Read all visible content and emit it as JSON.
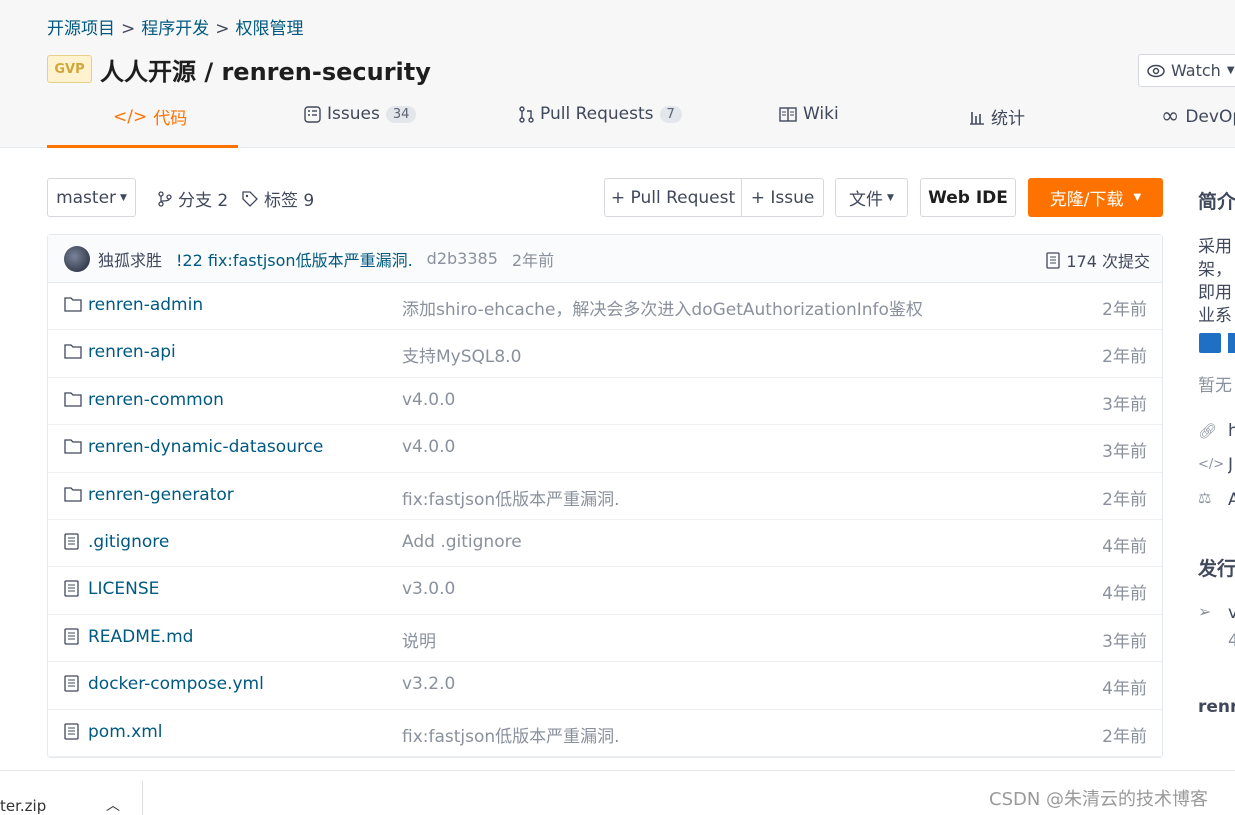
{
  "breadcrumb": {
    "items": [
      "开源项目",
      "程序开发",
      "权限管理"
    ],
    "sep": ">"
  },
  "repo": {
    "badge": "GVP",
    "title": "人人开源 / renren-security",
    "watch": "Watch"
  },
  "tabs": [
    {
      "label": "代码",
      "count": ""
    },
    {
      "label": "Issues",
      "count": "34"
    },
    {
      "label": "Pull Requests",
      "count": "7"
    },
    {
      "label": "Wiki",
      "count": ""
    },
    {
      "label": "统计",
      "count": ""
    },
    {
      "label": "DevOps",
      "count": ""
    }
  ],
  "toolbar": {
    "branch": "master",
    "branches": "分支 2",
    "tags": "标签 9",
    "pull_request": "+ Pull Request",
    "issue": "+ Issue",
    "file": "文件",
    "web_ide": "Web IDE",
    "clone": "克隆/下载"
  },
  "commit": {
    "author": "独孤求胜",
    "message": "!22 fix:fastjson低版本严重漏洞.",
    "hash": "d2b3385",
    "time": "2年前",
    "count": "174 次提交"
  },
  "files": [
    {
      "name": "renren-admin",
      "type": "folder",
      "message": "添加shiro-ehcache，解决会多次进入doGetAuthorizationInfo鉴权",
      "time": "2年前"
    },
    {
      "name": "renren-api",
      "type": "folder",
      "message": "支持MySQL8.0",
      "time": "2年前"
    },
    {
      "name": "renren-common",
      "type": "folder",
      "message": "v4.0.0",
      "time": "3年前"
    },
    {
      "name": "renren-dynamic-datasource",
      "type": "folder",
      "message": "v4.0.0",
      "time": "3年前"
    },
    {
      "name": "renren-generator",
      "type": "folder",
      "message": "fix:fastjson低版本严重漏洞.",
      "time": "2年前"
    },
    {
      "name": ".gitignore",
      "type": "file",
      "message": "Add .gitignore",
      "time": "4年前"
    },
    {
      "name": "LICENSE",
      "type": "file",
      "message": "v3.0.0",
      "time": "4年前"
    },
    {
      "name": "README.md",
      "type": "file",
      "message": "说明",
      "time": "3年前"
    },
    {
      "name": "docker-compose.yml",
      "type": "file",
      "message": "v3.2.0",
      "time": "4年前"
    },
    {
      "name": "pom.xml",
      "type": "file",
      "message": "fix:fastjson低版本严重漏洞.",
      "time": "2年前"
    }
  ],
  "sidebar": {
    "intro_title": "简介",
    "intro_lines": [
      "采用",
      "架，",
      "即用",
      "业系"
    ],
    "empty": "暂无",
    "links": [
      "h",
      "J",
      "A"
    ],
    "release_title": "发行",
    "release_item": "v",
    "release_sub": "4",
    "repo_name": "renr"
  },
  "download_bar": {
    "file": "ter.zip"
  },
  "watermark": "CSDN @朱清云的技术博客",
  "colors": {
    "accent": "#fe7300",
    "link": "#005980"
  }
}
